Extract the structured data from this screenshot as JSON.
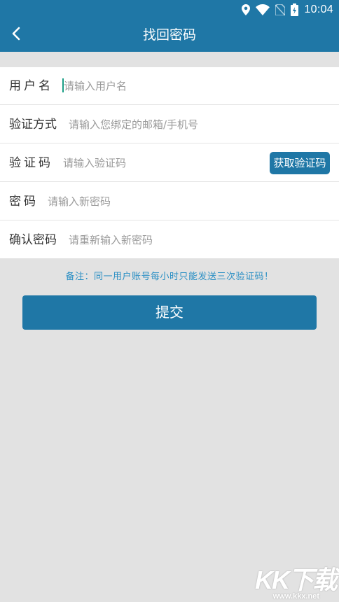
{
  "status_bar": {
    "time": "10:04"
  },
  "header": {
    "title": "找回密码",
    "back_icon": "chevron-left-icon"
  },
  "form": {
    "username": {
      "label": "用户名",
      "placeholder": "请输入用户名"
    },
    "verify_method": {
      "label": "验证方式",
      "placeholder": "请输入您绑定的邮箱/手机号"
    },
    "verify_code": {
      "label": "验证码",
      "placeholder": "请输入验证码",
      "button": "获取验证码"
    },
    "password": {
      "label": "密码",
      "placeholder": "请输入新密码"
    },
    "confirm_password": {
      "label": "确认密码",
      "placeholder": "请重新输入新密码"
    }
  },
  "note": "备注：同一用户账号每小时只能发送三次验证码！",
  "submit_label": "提交",
  "watermark": {
    "logo": "KK下载",
    "url": "www.kkx.net"
  },
  "colors": {
    "primary": "#1f77a6",
    "background": "#e2e2e2",
    "note": "#2a8fc4"
  }
}
